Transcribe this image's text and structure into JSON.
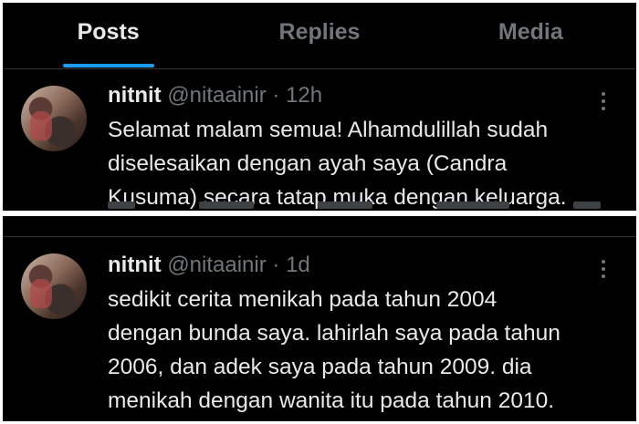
{
  "tabs": [
    {
      "label": "Posts",
      "active": true
    },
    {
      "label": "Replies",
      "active": false
    },
    {
      "label": "Media",
      "active": false
    }
  ],
  "tweets": [
    {
      "name": "nitnit",
      "handle": "@nitaainir",
      "separator": "·",
      "time": "12h",
      "text": "Selamat malam semua! Alhamdulillah sudah\ndiselesaikan dengan ayah saya (Candra\nKusuma) secara tatap muka dengan keluarga."
    },
    {
      "name": "nitnit",
      "handle": "@nitaainir",
      "separator": "·",
      "time": "1d",
      "text": "sedikit cerita menikah pada tahun 2004\ndengan bunda saya. lahirlah saya pada tahun\n2006, dan adek saya pada tahun 2009. dia\nmenikah dengan wanita itu pada tahun 2010."
    }
  ],
  "icons": [
    "more-icon",
    "avatar"
  ],
  "colors": {
    "background": "#000000",
    "accent": "#1d9bf0",
    "secondary_text": "#71767b",
    "primary_text": "#e7e9ea"
  }
}
